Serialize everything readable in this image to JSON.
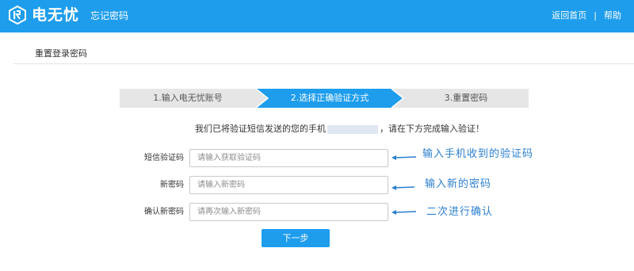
{
  "header": {
    "logo_text": "电无忧",
    "subtitle": "忘记密码",
    "links": {
      "home": "返回首页",
      "separator": "|",
      "help": "帮助"
    },
    "bg_color": "#1e9ded"
  },
  "page_title": "重置登录密码",
  "steps": [
    {
      "label": "1.输入电无忧账号",
      "active": false
    },
    {
      "label": "2.选择正确验证方式",
      "active": true
    },
    {
      "label": "3.重置密码",
      "active": false
    }
  ],
  "notice": {
    "before": "我们已将验证短信发送的您的手机",
    "after": "，请在下方完成输入验证！"
  },
  "form": {
    "sms": {
      "label": "短信验证码",
      "placeholder": "请输入获取验证码"
    },
    "new_password": {
      "label": "新密码",
      "placeholder": "请输入新密码"
    },
    "confirm_password": {
      "label": "确认新密码",
      "placeholder": "请再次输入新密码"
    }
  },
  "annotations": {
    "sms": "输入手机收到的验证码",
    "new_password": "输入新的密码",
    "confirm_password": "二次进行确认"
  },
  "next_button": "下一步",
  "icons": {
    "logo": "logo-icon",
    "arrow": "arrow-left-icon"
  },
  "colors": {
    "accent": "#1e9ded",
    "step_bg": "#e6e6e6",
    "annotation": "#2b7fd0"
  }
}
